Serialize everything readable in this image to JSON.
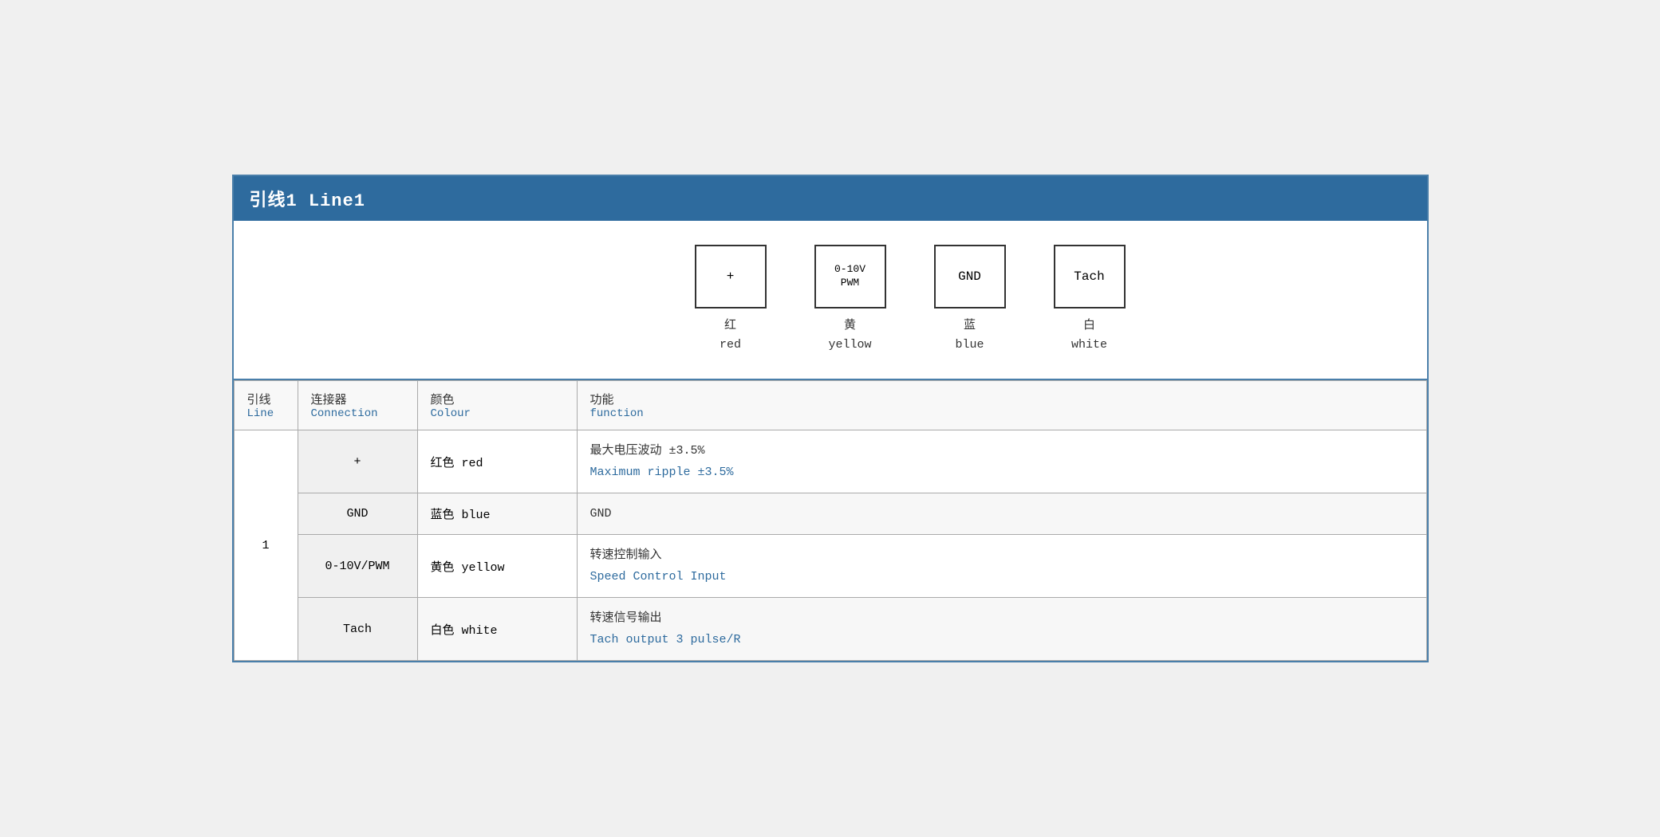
{
  "title": "引线1 Line1",
  "pins": [
    {
      "id": "pin-plus",
      "label": "+",
      "zh": "红",
      "en": "red"
    },
    {
      "id": "pin-pwm",
      "label": "0-10V\nPWM",
      "zh": "黄",
      "en": "yellow"
    },
    {
      "id": "pin-gnd",
      "label": "GND",
      "zh": "蓝",
      "en": "blue"
    },
    {
      "id": "pin-tach",
      "label": "Tach",
      "zh": "白",
      "en": "white"
    }
  ],
  "table": {
    "headers": {
      "line_zh": "引线",
      "line_en": "Line",
      "connection_zh": "连接器",
      "connection_en": "Connection",
      "colour_zh": "颜色",
      "colour_en": "Colour",
      "function_zh": "功能",
      "function_en": "function"
    },
    "rows": [
      {
        "line": "1",
        "connector": "+",
        "colour_zh": "红色 red",
        "function_zh": "最大电压波动 ±3.5%",
        "function_en": "Maximum ripple ±3.5%"
      },
      {
        "line": "1",
        "connector": "GND",
        "colour_zh": "蓝色 blue",
        "function_zh": "GND",
        "function_en": ""
      },
      {
        "line": "1",
        "connector": "0-10V/PWM",
        "colour_zh": "黄色 yellow",
        "function_zh": "转速控制输入",
        "function_en": "Speed Control Input"
      },
      {
        "line": "1",
        "connector": "Tach",
        "colour_zh": "白色 white",
        "function_zh": "转速信号输出",
        "function_en": "Tach output 3 pulse/R"
      }
    ]
  }
}
